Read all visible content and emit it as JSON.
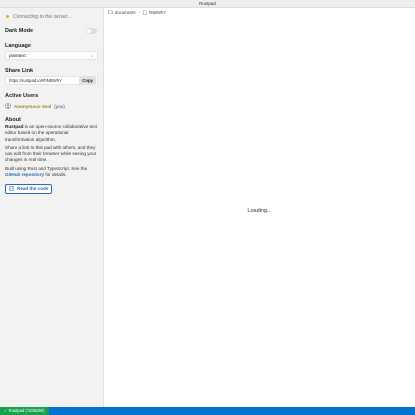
{
  "window": {
    "title": "Rustpad"
  },
  "sidebar": {
    "connection_status": "Connecting to the server...",
    "dark_mode_label": "Dark Mode",
    "language_title": "Language",
    "language_selected": "plaintext",
    "share_title": "Share Link",
    "share_url": "https://rustpad.io/#hNBWhY",
    "copy_label": "Copy",
    "active_users_title": "Active Users",
    "users": [
      {
        "name": "Anonymous Seal",
        "suffix": "(you)"
      }
    ],
    "about_title": "About",
    "about": {
      "p1_strong": "Rustpad",
      "p1_rest": " is an open-source collaborative text editor based on the operational transformation algorithm.",
      "p2": "Share a link to this pad with others, and they can edit from their browser while seeing your changes in real time.",
      "p3_a": "Built using Rust and TypeScript. See the ",
      "p3_link": "GitHub repository",
      "p3_b": " for details."
    },
    "read_code_label": "Read the code"
  },
  "main": {
    "breadcrumb": [
      "documents",
      "hNBWhY"
    ],
    "loading_text": "Loading..."
  },
  "statusbar": {
    "version": "✓ Rustpad (7d36d90)"
  },
  "colors": {
    "accent": "#2b6cb0",
    "statusbar": "#0074cc",
    "status_item": "#17a04a",
    "connecting_dot": "#e8a13a",
    "user_name": "#9a8a2e"
  },
  "icons": {
    "connection": "status-dot-icon",
    "select": "chevron-down-icon",
    "user": "user-icon",
    "code": "code-icon",
    "folder": "folder-icon",
    "file": "file-icon"
  }
}
